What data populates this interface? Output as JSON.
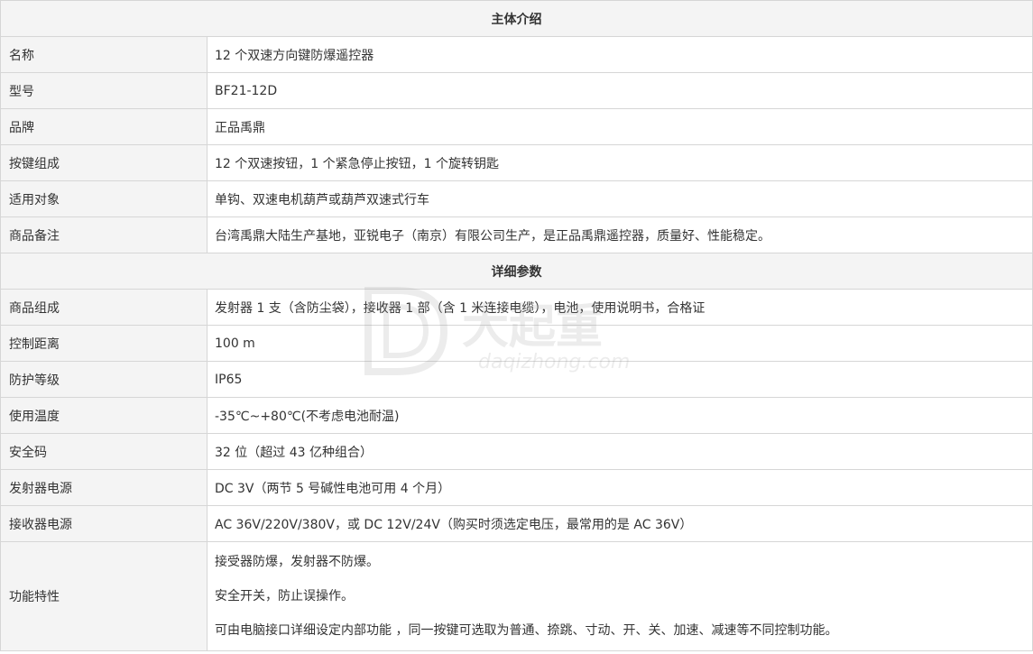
{
  "sections": {
    "intro_title": "主体介绍",
    "params_title": "详细参数"
  },
  "intro_rows": [
    {
      "label": "名称",
      "value": "12 个双速方向键防爆遥控器"
    },
    {
      "label": "型号",
      "value": "BF21-12D"
    },
    {
      "label": "品牌",
      "value": "正品禹鼎"
    },
    {
      "label": "按键组成",
      "value": "12 个双速按钮，1 个紧急停止按钮，1 个旋转钥匙"
    },
    {
      "label": "适用对象",
      "value": "单钩、双速电机葫芦或葫芦双速式行车"
    },
    {
      "label": "商品备注",
      "value": "台湾禹鼎大陆生产基地，亚锐电子（南京）有限公司生产，是正品禹鼎遥控器，质量好、性能稳定。"
    }
  ],
  "param_rows": [
    {
      "label": "商品组成",
      "value": "发射器 1 支（含防尘袋），接收器 1 部（含 1 米连接电缆），电池，使用说明书，合格证"
    },
    {
      "label": "控制距离",
      "value": "100 m"
    },
    {
      "label": "防护等级",
      "value": "IP65"
    },
    {
      "label": "使用温度",
      "value": "-35℃~+80℃(不考虑电池耐温)"
    },
    {
      "label": "安全码",
      "value": "32 位（超过 43 亿种组合）"
    },
    {
      "label": "发射器电源",
      "value": "DC 3V（两节 5 号碱性电池可用 4 个月）"
    },
    {
      "label": "接收器电源",
      "value": "AC 36V/220V/380V，或 DC 12V/24V（购买时须选定电压，最常用的是 AC 36V）"
    }
  ],
  "feature_row": {
    "label": "功能特性",
    "lines": [
      "接受器防爆，发射器不防爆。",
      "安全开关，防止误操作。",
      "可由电脑接口详细设定内部功能 ，同一按键可选取为普通、捺跳、寸动、开、关、加速、减速等不同控制功能。"
    ]
  },
  "watermark": {
    "brand": "大起重",
    "domain": "daqizhong.com",
    "icon": "dq-logo-icon"
  },
  "colors": {
    "header_bg": "#f4f4f4",
    "border": "#d6d6d6",
    "text": "#333333"
  }
}
